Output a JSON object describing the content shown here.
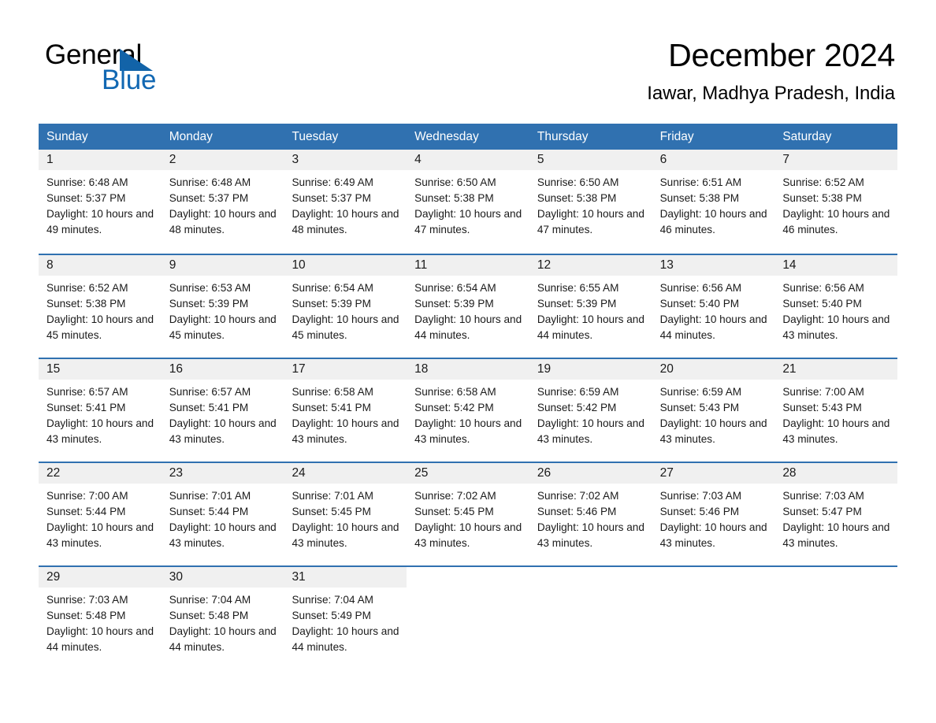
{
  "brand": {
    "name_part1": "General",
    "name_part2": "Blue",
    "triangle_icon": "triangle-icon",
    "accent_color": "#1268b3"
  },
  "header": {
    "title": "December 2024",
    "subtitle": "Iawar, Madhya Pradesh, India"
  },
  "theme": {
    "header_blue": "#3071b0",
    "daynum_bg": "#f0f0f0",
    "text": "#1a1a1a"
  },
  "calendar": {
    "weekday_headers": [
      "Sunday",
      "Monday",
      "Tuesday",
      "Wednesday",
      "Thursday",
      "Friday",
      "Saturday"
    ],
    "weeks": [
      [
        {
          "day": "1",
          "sunrise": "Sunrise: 6:48 AM",
          "sunset": "Sunset: 5:37 PM",
          "daylight": "Daylight: 10 hours and 49 minutes."
        },
        {
          "day": "2",
          "sunrise": "Sunrise: 6:48 AM",
          "sunset": "Sunset: 5:37 PM",
          "daylight": "Daylight: 10 hours and 48 minutes."
        },
        {
          "day": "3",
          "sunrise": "Sunrise: 6:49 AM",
          "sunset": "Sunset: 5:37 PM",
          "daylight": "Daylight: 10 hours and 48 minutes."
        },
        {
          "day": "4",
          "sunrise": "Sunrise: 6:50 AM",
          "sunset": "Sunset: 5:38 PM",
          "daylight": "Daylight: 10 hours and 47 minutes."
        },
        {
          "day": "5",
          "sunrise": "Sunrise: 6:50 AM",
          "sunset": "Sunset: 5:38 PM",
          "daylight": "Daylight: 10 hours and 47 minutes."
        },
        {
          "day": "6",
          "sunrise": "Sunrise: 6:51 AM",
          "sunset": "Sunset: 5:38 PM",
          "daylight": "Daylight: 10 hours and 46 minutes."
        },
        {
          "day": "7",
          "sunrise": "Sunrise: 6:52 AM",
          "sunset": "Sunset: 5:38 PM",
          "daylight": "Daylight: 10 hours and 46 minutes."
        }
      ],
      [
        {
          "day": "8",
          "sunrise": "Sunrise: 6:52 AM",
          "sunset": "Sunset: 5:38 PM",
          "daylight": "Daylight: 10 hours and 45 minutes."
        },
        {
          "day": "9",
          "sunrise": "Sunrise: 6:53 AM",
          "sunset": "Sunset: 5:39 PM",
          "daylight": "Daylight: 10 hours and 45 minutes."
        },
        {
          "day": "10",
          "sunrise": "Sunrise: 6:54 AM",
          "sunset": "Sunset: 5:39 PM",
          "daylight": "Daylight: 10 hours and 45 minutes."
        },
        {
          "day": "11",
          "sunrise": "Sunrise: 6:54 AM",
          "sunset": "Sunset: 5:39 PM",
          "daylight": "Daylight: 10 hours and 44 minutes."
        },
        {
          "day": "12",
          "sunrise": "Sunrise: 6:55 AM",
          "sunset": "Sunset: 5:39 PM",
          "daylight": "Daylight: 10 hours and 44 minutes."
        },
        {
          "day": "13",
          "sunrise": "Sunrise: 6:56 AM",
          "sunset": "Sunset: 5:40 PM",
          "daylight": "Daylight: 10 hours and 44 minutes."
        },
        {
          "day": "14",
          "sunrise": "Sunrise: 6:56 AM",
          "sunset": "Sunset: 5:40 PM",
          "daylight": "Daylight: 10 hours and 43 minutes."
        }
      ],
      [
        {
          "day": "15",
          "sunrise": "Sunrise: 6:57 AM",
          "sunset": "Sunset: 5:41 PM",
          "daylight": "Daylight: 10 hours and 43 minutes."
        },
        {
          "day": "16",
          "sunrise": "Sunrise: 6:57 AM",
          "sunset": "Sunset: 5:41 PM",
          "daylight": "Daylight: 10 hours and 43 minutes."
        },
        {
          "day": "17",
          "sunrise": "Sunrise: 6:58 AM",
          "sunset": "Sunset: 5:41 PM",
          "daylight": "Daylight: 10 hours and 43 minutes."
        },
        {
          "day": "18",
          "sunrise": "Sunrise: 6:58 AM",
          "sunset": "Sunset: 5:42 PM",
          "daylight": "Daylight: 10 hours and 43 minutes."
        },
        {
          "day": "19",
          "sunrise": "Sunrise: 6:59 AM",
          "sunset": "Sunset: 5:42 PM",
          "daylight": "Daylight: 10 hours and 43 minutes."
        },
        {
          "day": "20",
          "sunrise": "Sunrise: 6:59 AM",
          "sunset": "Sunset: 5:43 PM",
          "daylight": "Daylight: 10 hours and 43 minutes."
        },
        {
          "day": "21",
          "sunrise": "Sunrise: 7:00 AM",
          "sunset": "Sunset: 5:43 PM",
          "daylight": "Daylight: 10 hours and 43 minutes."
        }
      ],
      [
        {
          "day": "22",
          "sunrise": "Sunrise: 7:00 AM",
          "sunset": "Sunset: 5:44 PM",
          "daylight": "Daylight: 10 hours and 43 minutes."
        },
        {
          "day": "23",
          "sunrise": "Sunrise: 7:01 AM",
          "sunset": "Sunset: 5:44 PM",
          "daylight": "Daylight: 10 hours and 43 minutes."
        },
        {
          "day": "24",
          "sunrise": "Sunrise: 7:01 AM",
          "sunset": "Sunset: 5:45 PM",
          "daylight": "Daylight: 10 hours and 43 minutes."
        },
        {
          "day": "25",
          "sunrise": "Sunrise: 7:02 AM",
          "sunset": "Sunset: 5:45 PM",
          "daylight": "Daylight: 10 hours and 43 minutes."
        },
        {
          "day": "26",
          "sunrise": "Sunrise: 7:02 AM",
          "sunset": "Sunset: 5:46 PM",
          "daylight": "Daylight: 10 hours and 43 minutes."
        },
        {
          "day": "27",
          "sunrise": "Sunrise: 7:03 AM",
          "sunset": "Sunset: 5:46 PM",
          "daylight": "Daylight: 10 hours and 43 minutes."
        },
        {
          "day": "28",
          "sunrise": "Sunrise: 7:03 AM",
          "sunset": "Sunset: 5:47 PM",
          "daylight": "Daylight: 10 hours and 43 minutes."
        }
      ],
      [
        {
          "day": "29",
          "sunrise": "Sunrise: 7:03 AM",
          "sunset": "Sunset: 5:48 PM",
          "daylight": "Daylight: 10 hours and 44 minutes."
        },
        {
          "day": "30",
          "sunrise": "Sunrise: 7:04 AM",
          "sunset": "Sunset: 5:48 PM",
          "daylight": "Daylight: 10 hours and 44 minutes."
        },
        {
          "day": "31",
          "sunrise": "Sunrise: 7:04 AM",
          "sunset": "Sunset: 5:49 PM",
          "daylight": "Daylight: 10 hours and 44 minutes."
        },
        {
          "day": "",
          "sunrise": "",
          "sunset": "",
          "daylight": ""
        },
        {
          "day": "",
          "sunrise": "",
          "sunset": "",
          "daylight": ""
        },
        {
          "day": "",
          "sunrise": "",
          "sunset": "",
          "daylight": ""
        },
        {
          "day": "",
          "sunrise": "",
          "sunset": "",
          "daylight": ""
        }
      ]
    ]
  }
}
